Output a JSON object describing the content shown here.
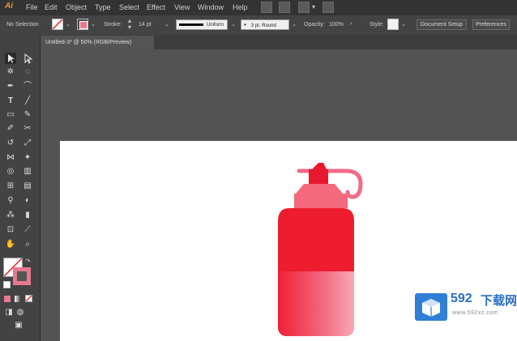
{
  "app": {
    "logo": "Ai"
  },
  "menu": [
    "File",
    "Edit",
    "Object",
    "Type",
    "Select",
    "Effect",
    "View",
    "Window",
    "Help"
  ],
  "control_bar": {
    "selection_label": "No Selection",
    "stroke_label": "Stroke:",
    "stroke_weight": "14 pt",
    "profile_label": "Uniform",
    "brush_label": "3 pt. Round",
    "opacity_label": "Opacity:",
    "opacity_value": "100%",
    "style_label": "Style:",
    "document_setup_label": "Document Setup",
    "preferences_label": "Preferences",
    "dropdown_glyph": "⌄",
    "stroke_color": "#e8788e"
  },
  "document_tab": {
    "title": "Untitled-3* @ 50% (RGB/Preview)"
  },
  "tools": {
    "fill_color": "#ffffff",
    "stroke_color": "#e8788e"
  },
  "artwork": {
    "bottle_primary": "#ed1c2e",
    "bottle_cap_pink": "#f5697d",
    "bottle_hook": "#f06b87"
  },
  "watermark": {
    "brand_number": "592",
    "brand_cn": "下载网",
    "url": "www.592xz.com",
    "color": "#2a70c4"
  }
}
